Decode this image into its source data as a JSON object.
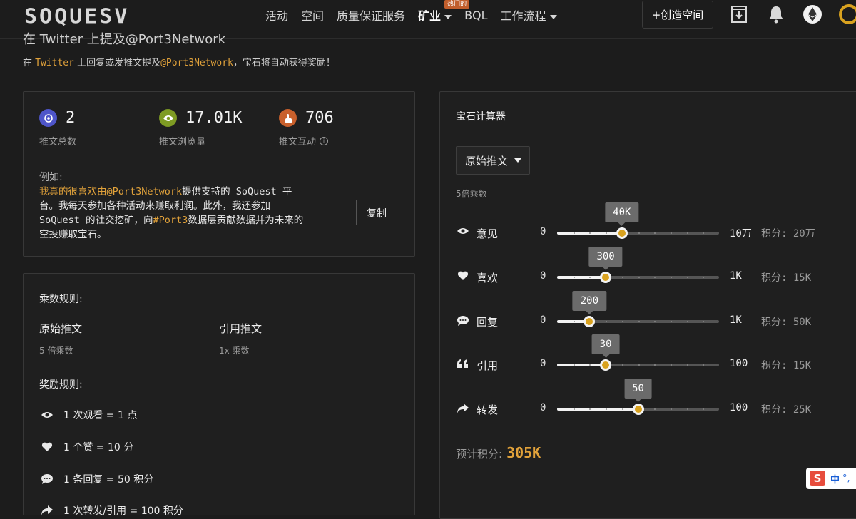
{
  "header": {
    "logo": "SOQUESV",
    "nav": [
      {
        "label": "活动",
        "dropdown": false
      },
      {
        "label": "空间",
        "dropdown": false
      },
      {
        "label": "质量保证服务",
        "dropdown": false
      },
      {
        "label": "矿业",
        "dropdown": true,
        "bold": true
      },
      {
        "label": "BQL",
        "dropdown": false,
        "badge": "热门的"
      },
      {
        "label": "工作流程",
        "dropdown": true
      }
    ],
    "create_button": "+创造空间",
    "icons": [
      "download-icon",
      "bell-icon",
      "ethereum-icon",
      "avatar"
    ]
  },
  "page": {
    "heading": "在 Twitter 上提及@Port3Network",
    "sub_prefix": "在",
    "sub_twitter": "Twitter",
    "sub_mid": "上回复或发推文提及",
    "sub_handle": "@Port3Network",
    "sub_suffix": "，宝石将自动获得奖励！"
  },
  "stats": [
    {
      "icon": "twitter-icon",
      "value": "2",
      "label": "推文总数",
      "color": "#4e55c9"
    },
    {
      "icon": "eye-icon",
      "value": "17.01K",
      "label": "推文浏览量",
      "color": "#7e9b23"
    },
    {
      "icon": "pointer-icon",
      "value": "706",
      "label": "推文互动",
      "color": "#c9602c"
    }
  ],
  "example": {
    "label": "例如:",
    "hl1": "我真的很喜欢由@Port3Network",
    "t1": "提供支持的 SoQuest 平台。我每天参加各种活动来赚取利润。此外，我还参加 SoQuest 的社交挖矿，向",
    "hl2": "#Port3",
    "t2": "数据层贡献数据并为未来的空投赚取宝石。",
    "copy": "复制"
  },
  "rules": {
    "multiplier_title": "乘数规则:",
    "original_name": "原始推文",
    "original_sub": "5 倍乘数",
    "quote_name": "引用推文",
    "quote_sub": "1x 乘数",
    "reward_title": "奖励规则:",
    "rewards": [
      {
        "icon": "eye-icon",
        "text": "1 次观看 = 1 点"
      },
      {
        "icon": "heart-icon",
        "text": "1 个赞 = 10 分"
      },
      {
        "icon": "comment-icon",
        "text": "1 条回复 = 50 积分"
      },
      {
        "icon": "share-icon",
        "text": "1 次转发/引用 = 100 积分"
      }
    ]
  },
  "calculator": {
    "title": "宝石计算器",
    "dropdown_value": "原始推文",
    "multiplier_label": "5倍乘数",
    "sliders": [
      {
        "icon": "eye-icon",
        "label": "意见",
        "min": "0",
        "max": "10万",
        "tooltip": "40K",
        "fraction": 0.4,
        "score": "积分: 20万"
      },
      {
        "icon": "heart-icon",
        "label": "喜欢",
        "min": "0",
        "max": "1K",
        "tooltip": "300",
        "fraction": 0.3,
        "score": "积分: 15K"
      },
      {
        "icon": "comment-icon",
        "label": "回复",
        "min": "0",
        "max": "1K",
        "tooltip": "200",
        "fraction": 0.2,
        "score": "积分: 50K"
      },
      {
        "icon": "quote-icon",
        "label": "引用",
        "min": "0",
        "max": "100",
        "tooltip": "30",
        "fraction": 0.3,
        "score": "积分: 15K"
      },
      {
        "icon": "share-icon",
        "label": "转发",
        "min": "0",
        "max": "100",
        "tooltip": "50",
        "fraction": 0.5,
        "score": "积分: 25K"
      }
    ],
    "estimate_label": "预计积分:",
    "estimate_value": "305K"
  },
  "ime": {
    "zh": "中",
    "dot": "°,"
  }
}
